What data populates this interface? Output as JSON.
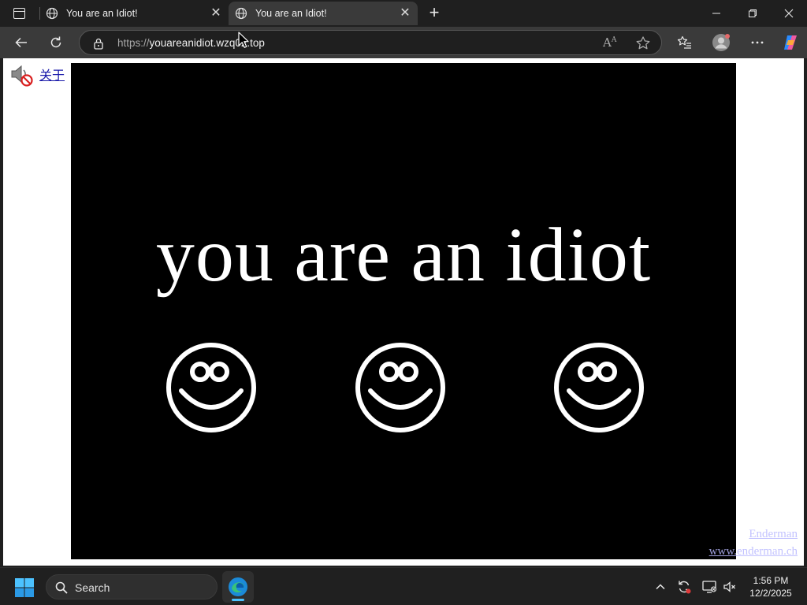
{
  "browser": {
    "tabs": [
      {
        "title": "You are an Idiot!",
        "active": false
      },
      {
        "title": "You are an Idiot!",
        "active": true
      }
    ],
    "address": {
      "scheme": "https://",
      "host": "youareanidiot.wzq02.top"
    },
    "readaloud_label": "A"
  },
  "page": {
    "about_link": "关于",
    "message": "you are an idiot",
    "smiley_count": 3,
    "watermark_line1": "Enderman",
    "watermark_line2": "www.enderman.ch"
  },
  "taskbar": {
    "search_label": "Search",
    "time": "1:56 PM",
    "date": "12/2/2025"
  },
  "colors": {
    "accent": "#0078d4",
    "stage_bg": "#000000",
    "message": "#ffffff"
  }
}
